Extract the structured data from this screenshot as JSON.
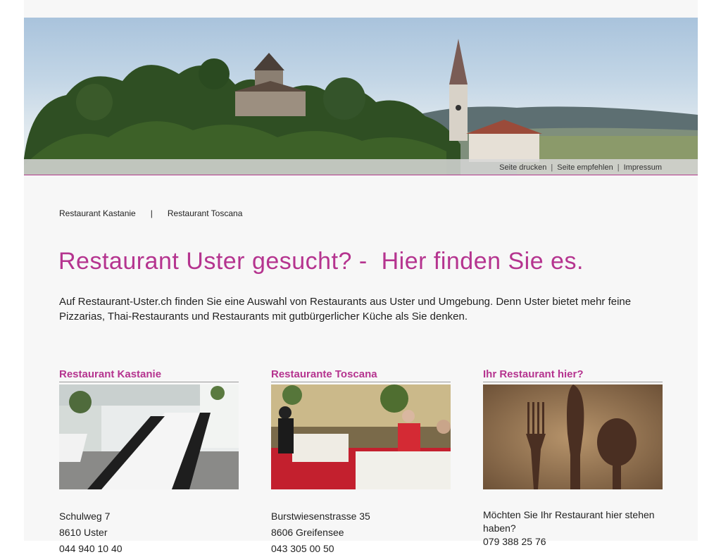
{
  "utility": {
    "print": "Seite drucken",
    "recommend": "Seite empfehlen",
    "imprint": "Impressum",
    "sep": "|"
  },
  "topnav": {
    "items": [
      "Restaurant Kastanie",
      "Restaurant Toscana"
    ],
    "sep": "|"
  },
  "headline": "Restaurant Uster gesucht? -  Hier finden Sie es.",
  "intro": "Auf Restaurant-Uster.ch finden Sie eine Auswahl von Restaurants aus Uster und Umgebung. Denn Uster bietet mehr feine Pizzarias, Thai-Restaurants und Restaurants mit gutbürgerlicher Küche als Sie denken.",
  "cards": [
    {
      "title": "Restaurant Kastanie",
      "lines": [
        "Schulweg 7",
        "8610 Uster",
        "044 940 10 40"
      ]
    },
    {
      "title": "Restaurante Toscana",
      "lines": [
        "Burstwiesenstrasse 35",
        "8606 Greifensee",
        "043 305 00 50"
      ]
    },
    {
      "title": "Ihr Restaurant hier?",
      "lines": [
        "Möchten Sie Ihr Restaurant hier stehen haben?",
        "079 388 25 76"
      ]
    }
  ],
  "colors": {
    "accent": "#b5348f",
    "page_bg": "#f7f7f7"
  }
}
